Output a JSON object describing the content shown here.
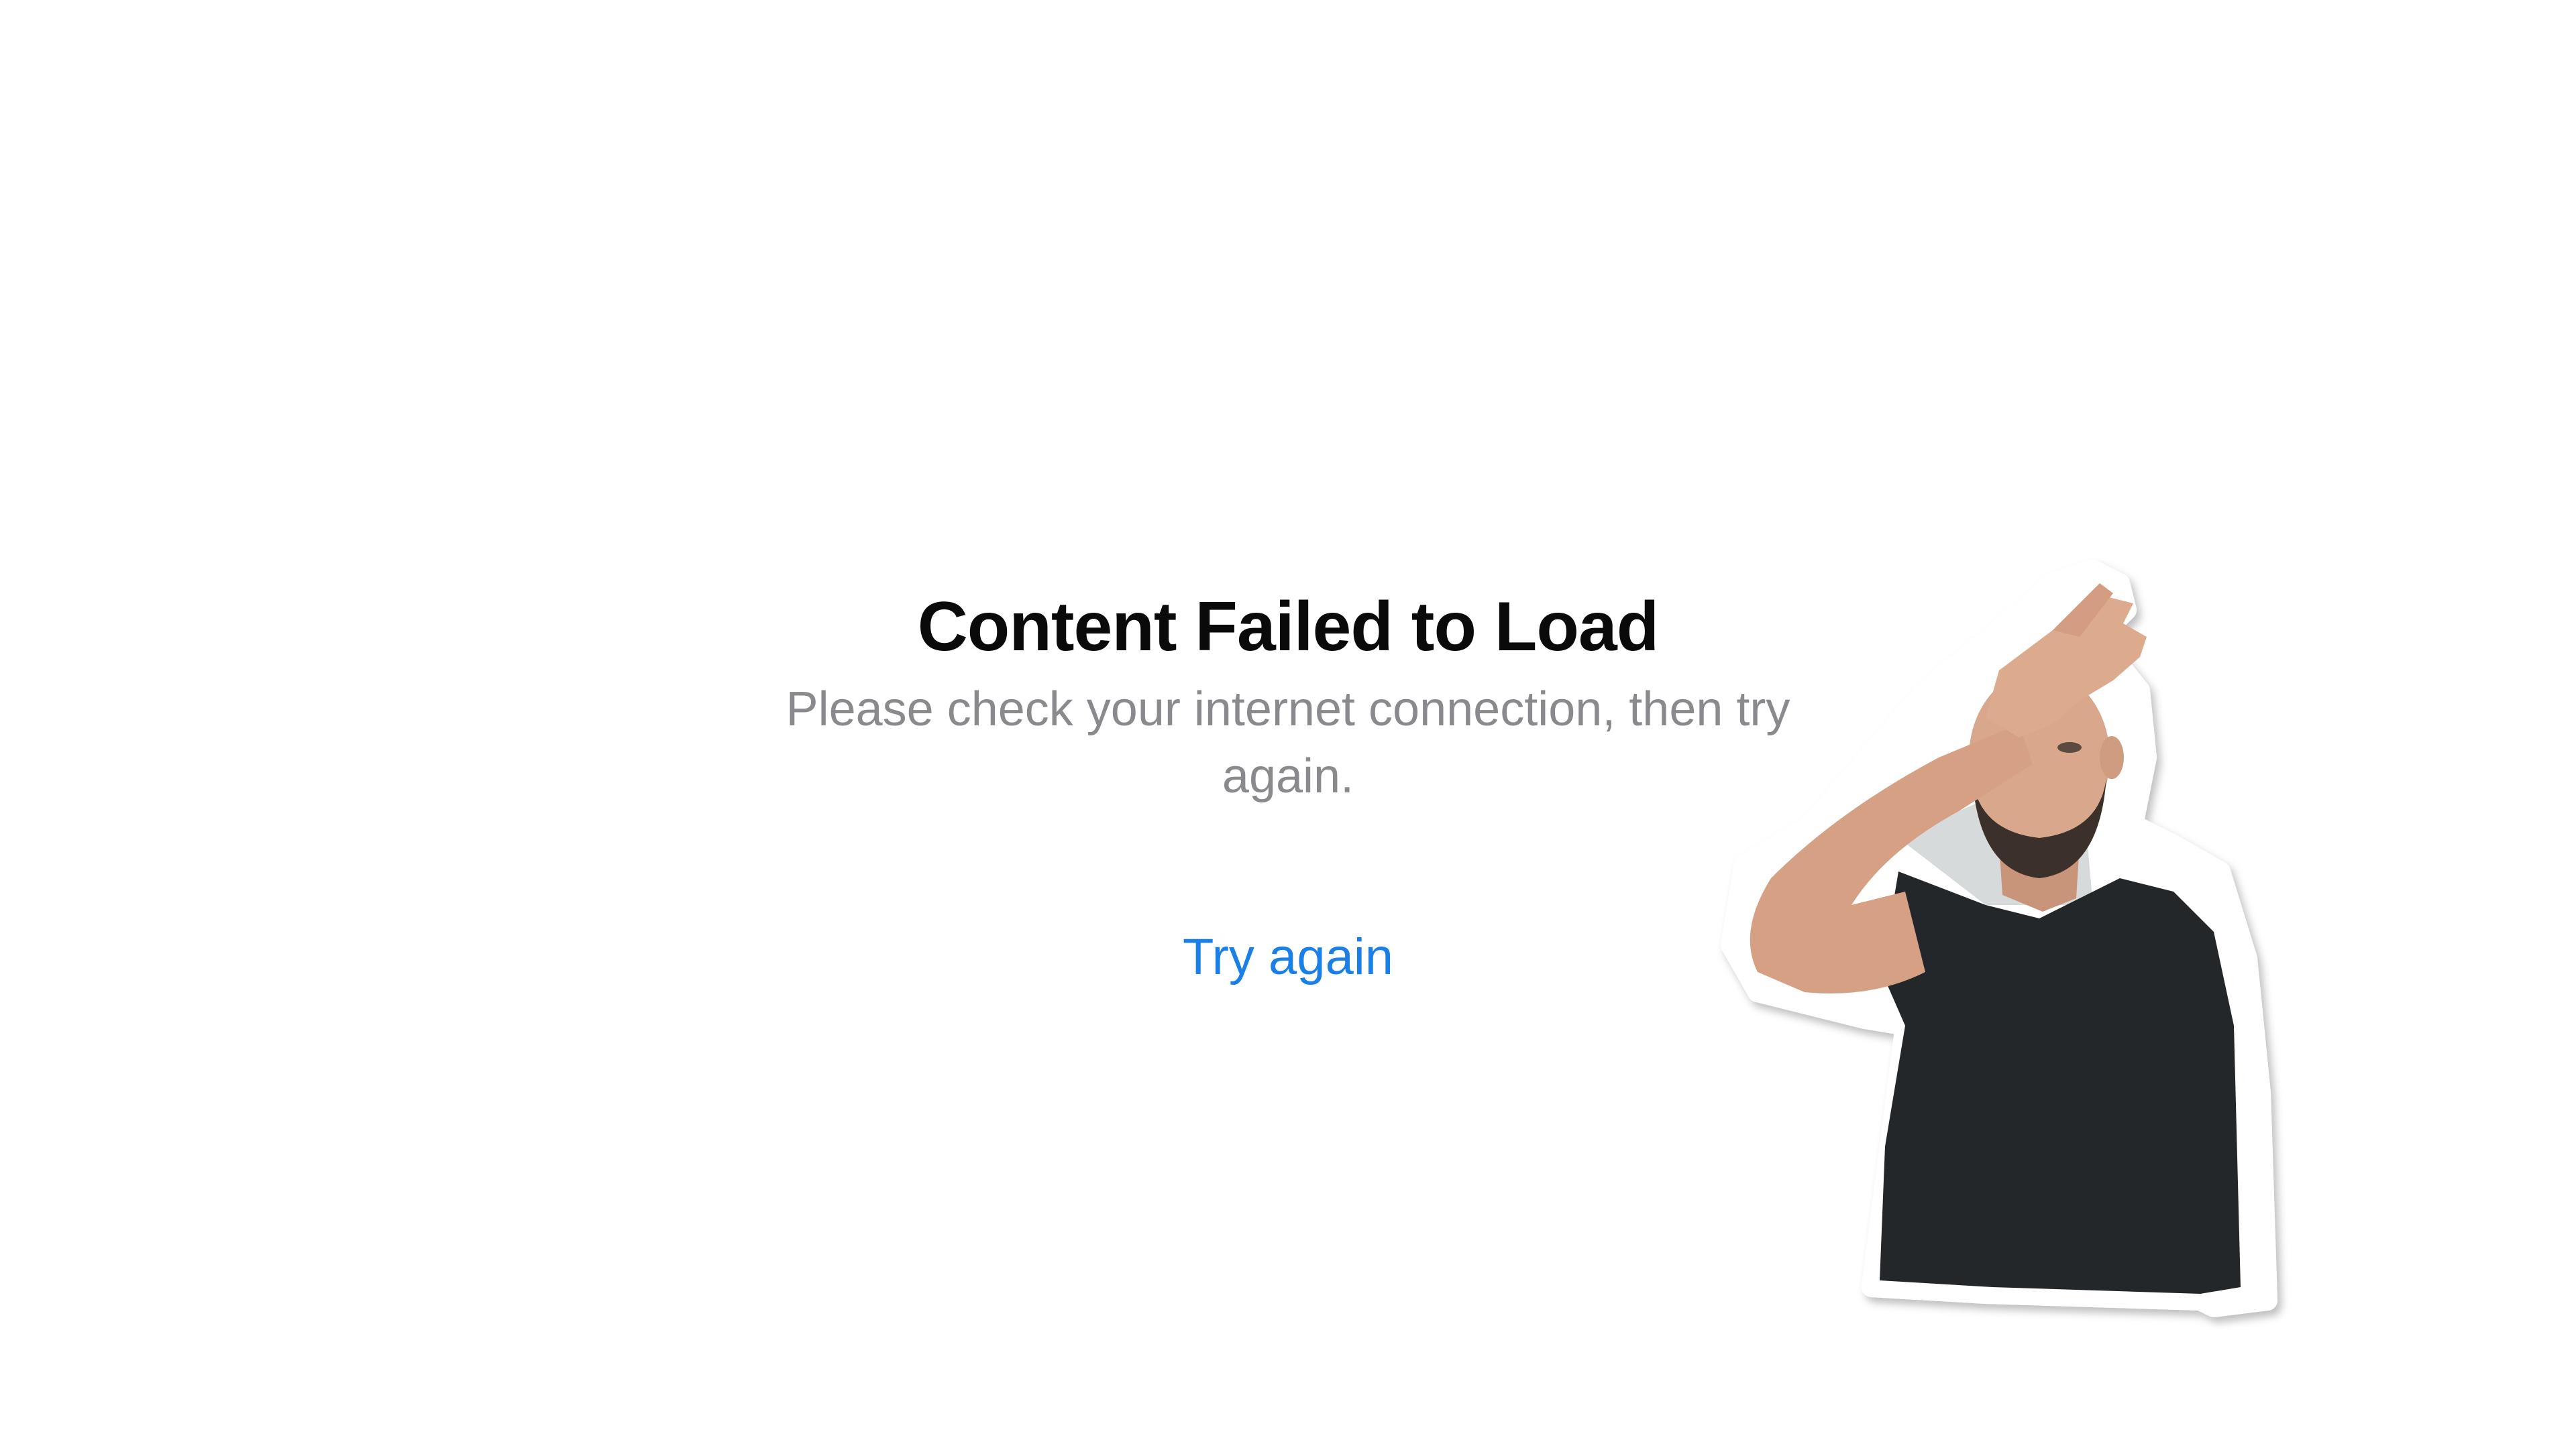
{
  "error": {
    "title": "Content Failed to Load",
    "message": "Please check your internet connection, then try again.",
    "retry_label": "Try again"
  },
  "colors": {
    "title": "#0a0a0a",
    "message": "#8a8a8e",
    "link": "#1a7fe6"
  },
  "sticker": {
    "icon": "facepalm-person-sticker"
  }
}
